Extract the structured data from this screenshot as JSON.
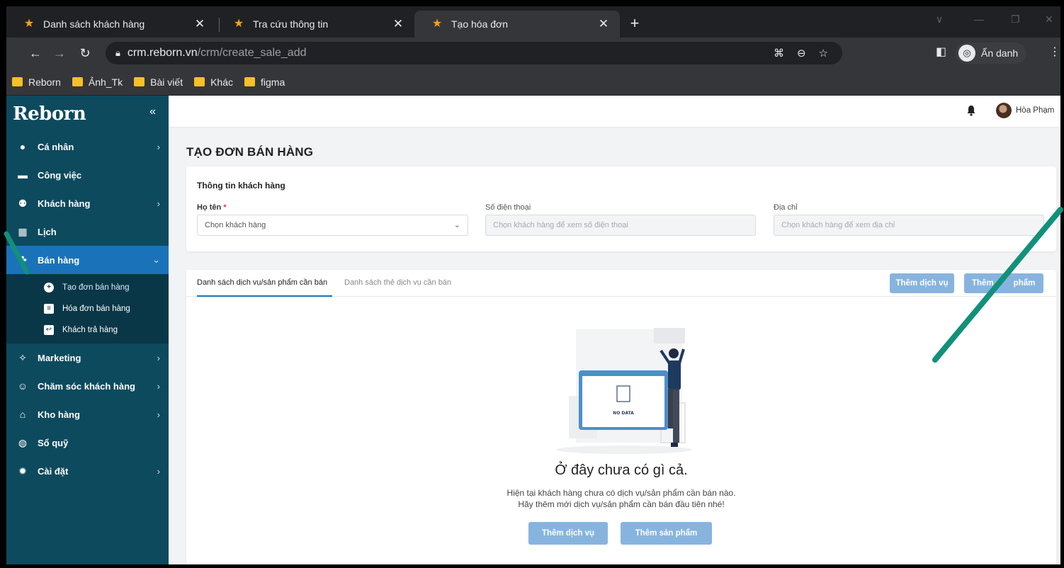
{
  "browser": {
    "tabs": [
      {
        "title": "Danh sách khách hàng"
      },
      {
        "title": "Tra cứu thông tin"
      },
      {
        "title": "Tạo hóa đơn"
      }
    ],
    "url_host": "crm.reborn.vn",
    "url_path": "/crm/create_sale_add",
    "incognito_label": "Ẩn danh",
    "bookmarks": [
      {
        "label": "Reborn"
      },
      {
        "label": "Ảnh_Tk"
      },
      {
        "label": "Bài viết"
      },
      {
        "label": "Khác"
      },
      {
        "label": "figma"
      }
    ],
    "colors": {
      "folder": "#f6c026",
      "favicon": "#f4a21b"
    }
  },
  "app": {
    "brand": "Reborn",
    "colors": {
      "sidebar": "#0d4a5e",
      "active": "#1a73b8",
      "button": "#87b4de",
      "annotation_line": "#12907a"
    },
    "sidebar": {
      "items": [
        {
          "label": "Cá nhân",
          "icon": "user-icon"
        },
        {
          "label": "Công việc",
          "icon": "briefcase-icon"
        },
        {
          "label": "Khách hàng",
          "icon": "users-icon"
        },
        {
          "label": "Lịch",
          "icon": "calendar-icon"
        },
        {
          "label": "Bán hàng",
          "icon": "sales-icon"
        },
        {
          "label": "Marketing",
          "icon": "megaphone-icon"
        },
        {
          "label": "Chăm sóc khách hàng",
          "icon": "support-icon"
        },
        {
          "label": "Kho hàng",
          "icon": "warehouse-icon"
        },
        {
          "label": "Sổ quỹ",
          "icon": "cashbook-icon"
        },
        {
          "label": "Cài đặt",
          "icon": "gear-icon"
        }
      ],
      "sub_items": [
        {
          "label": "Tạo đơn bán hàng"
        },
        {
          "label": "Hóa đơn bán hàng"
        },
        {
          "label": "Khách trả hàng"
        }
      ]
    },
    "user": {
      "name": "Hòa Phạm"
    }
  },
  "page": {
    "title": "TẠO ĐƠN BÁN HÀNG",
    "customer": {
      "section_title": "Thông tin khách hàng",
      "name_label": "Họ tên",
      "required_mark": "*",
      "name_value": "Chọn khách hàng",
      "phone_label": "Số điện thoại",
      "phone_placeholder": "Chọn khách hàng để xem số điện thoại",
      "address_label": "Địa chỉ",
      "address_placeholder": "Chọn khách hàng để xem địa chỉ"
    },
    "tabs": [
      {
        "label": "Danh sách dịch vụ/sản phẩm cần bán"
      },
      {
        "label": "Danh sách thẻ dịch vụ cần bán"
      }
    ],
    "add_service": "Thêm dịch vụ",
    "add_product_partial": "Thêm",
    "add_product_tail": "phẩm",
    "empty": {
      "art_label": "NO DATA",
      "title": "Ở đây chưa có gì cả.",
      "line1": "Hiện tại khách hàng chưa có dịch vụ/sản phẩm cần bán nào.",
      "line2": "Hãy thêm mới dịch vụ/sản phẩm cần bán đầu tiên nhé!",
      "add_service": "Thêm dịch vụ",
      "add_product": "Thêm sản phẩm"
    }
  }
}
